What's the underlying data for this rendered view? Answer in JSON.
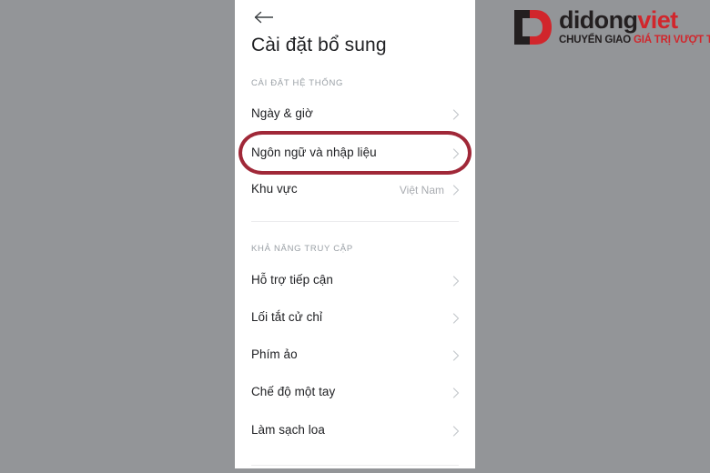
{
  "brand": {
    "mark_icon": "didongviet-logo-mark",
    "wordmark_dark": "didong",
    "wordmark_red": "viet",
    "tagline_dark": "CHUYỂN GIAO",
    "tagline_red": "GIÁ TRỊ VƯỢT TRỘI",
    "color_red": "#d1262c",
    "color_dark": "#231f20"
  },
  "screen": {
    "back_icon": "back-arrow-icon",
    "title": "Cài đặt bổ sung",
    "background": "#ffffff"
  },
  "sections": [
    {
      "label": "CÀI ĐẶT HỆ THỐNG",
      "rows": [
        {
          "label": "Ngày & giờ",
          "value": "",
          "chevron": "chevron-right-icon"
        },
        {
          "label": "Ngôn ngữ và nhập liệu",
          "value": "",
          "chevron": "chevron-right-icon"
        },
        {
          "label": "Khu vực",
          "value": "Việt Nam",
          "chevron": "chevron-right-icon"
        }
      ]
    },
    {
      "label": "KHẢ NĂNG TRUY CẬP",
      "rows": [
        {
          "label": "Hỗ trợ tiếp cận",
          "value": "",
          "chevron": "chevron-right-icon"
        },
        {
          "label": "Lối tắt cử chỉ",
          "value": "",
          "chevron": "chevron-right-icon"
        },
        {
          "label": "Phím ảo",
          "value": "",
          "chevron": "chevron-right-icon"
        },
        {
          "label": "Chế độ một tay",
          "value": "",
          "chevron": "chevron-right-icon"
        },
        {
          "label": "Làm sạch loa",
          "value": "",
          "chevron": "chevron-right-icon"
        }
      ]
    }
  ],
  "annotation": {
    "type": "ellipse-highlight",
    "target": "Ngôn ngữ và nhập liệu",
    "color": "#a02838"
  },
  "page_background": "#939598"
}
